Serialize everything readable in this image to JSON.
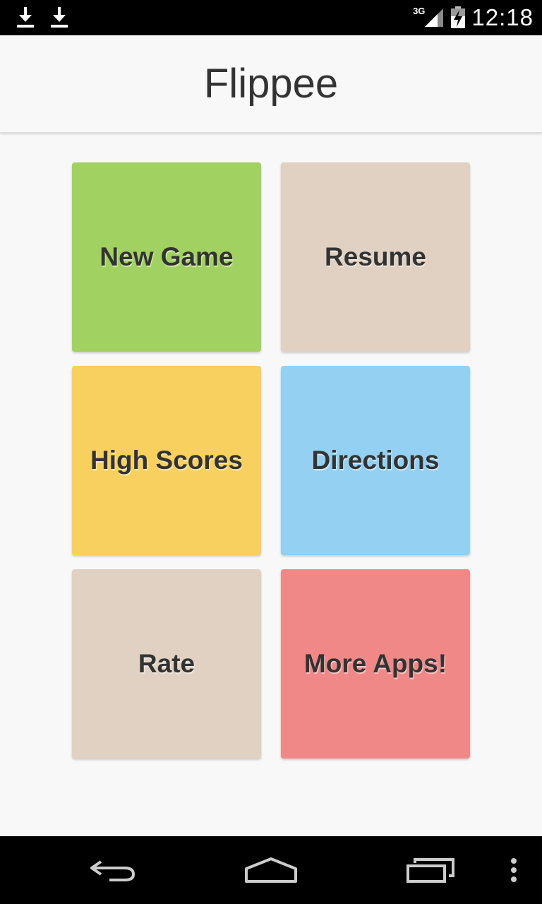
{
  "status_bar": {
    "network": "3G",
    "time": "12:18",
    "icons": [
      "download-icon",
      "download-icon",
      "signal-icon",
      "battery-charging-icon"
    ]
  },
  "app_bar": {
    "title": "Flippee"
  },
  "menu": {
    "tiles": [
      {
        "label": "New Game",
        "color": "#a1d160"
      },
      {
        "label": "Resume",
        "color": "#e0d1c2"
      },
      {
        "label": "High Scores",
        "color": "#f8d05f"
      },
      {
        "label": "Directions",
        "color": "#93d0f1"
      },
      {
        "label": "Rate",
        "color": "#e0d1c2"
      },
      {
        "label": "More Apps!",
        "color": "#f08888"
      }
    ]
  },
  "nav_bar": {
    "icons": [
      "back-icon",
      "home-icon",
      "recent-apps-icon",
      "overflow-menu-icon"
    ]
  }
}
